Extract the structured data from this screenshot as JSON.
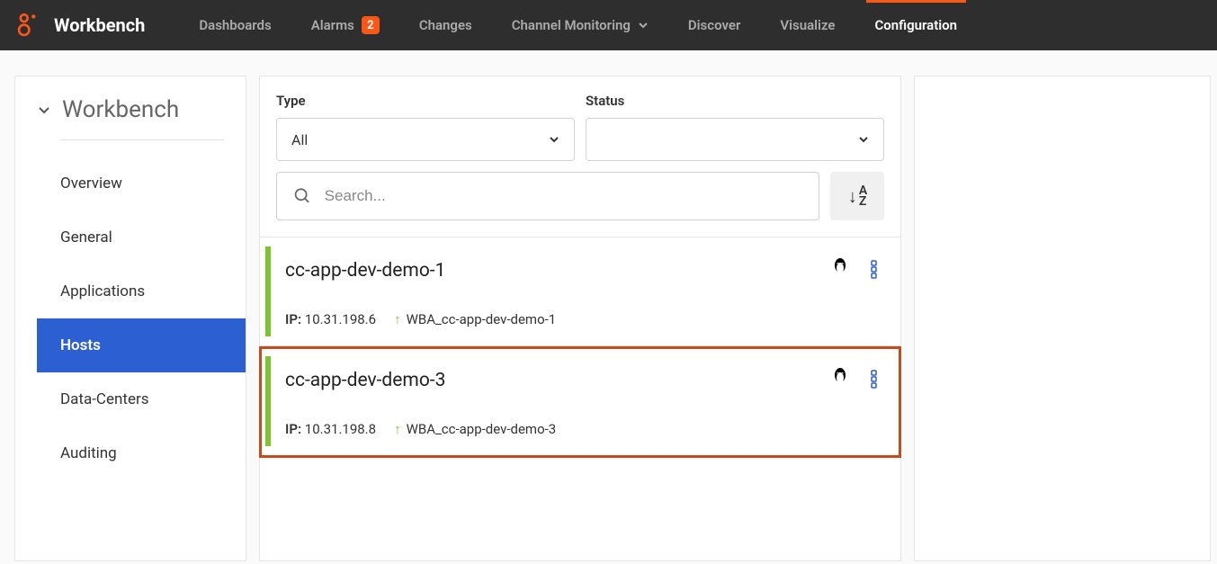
{
  "topnav": {
    "brand": "Workbench",
    "items": [
      {
        "label": "Dashboards",
        "badge": null
      },
      {
        "label": "Alarms",
        "badge": "2"
      },
      {
        "label": "Changes",
        "badge": null
      },
      {
        "label": "Channel Monitoring",
        "badge": null,
        "dropdown": true
      },
      {
        "label": "Discover",
        "badge": null
      },
      {
        "label": "Visualize",
        "badge": null
      },
      {
        "label": "Configuration",
        "badge": null,
        "active": true
      }
    ]
  },
  "sidebar": {
    "title": "Workbench",
    "items": [
      {
        "label": "Overview"
      },
      {
        "label": "General"
      },
      {
        "label": "Applications"
      },
      {
        "label": "Hosts",
        "active": true
      },
      {
        "label": "Data-Centers"
      },
      {
        "label": "Auditing"
      }
    ]
  },
  "filters": {
    "type_label": "Type",
    "type_value": "All",
    "status_label": "Status",
    "status_value": ""
  },
  "search": {
    "placeholder": "Search..."
  },
  "hosts": [
    {
      "name": "cc-app-dev-demo-1",
      "ip_label": "IP:",
      "ip": "10.31.198.6",
      "wba": "WBA_cc-app-dev-demo-1",
      "os_icon": "linux",
      "highlighted": false
    },
    {
      "name": "cc-app-dev-demo-3",
      "ip_label": "IP:",
      "ip": "10.31.198.8",
      "wba": "WBA_cc-app-dev-demo-3",
      "os_icon": "linux",
      "highlighted": true
    }
  ]
}
